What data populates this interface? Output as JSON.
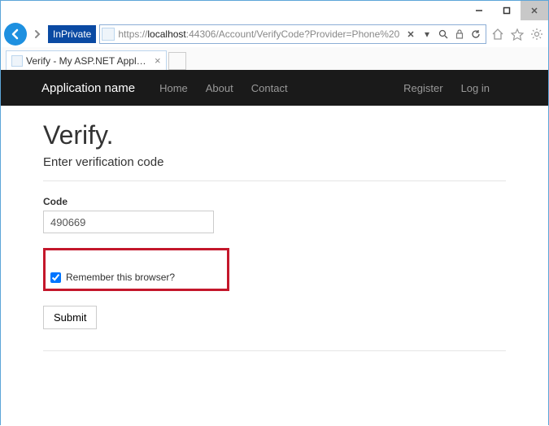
{
  "window": {
    "min": "—",
    "max": "☐",
    "close": "✕"
  },
  "browser": {
    "inprivate": "InPrivate",
    "url_prefix": "https://",
    "url_host": "localhost",
    "url_rest": ":44306/Account/VerifyCode?Provider=Phone%20",
    "tab_title": "Verify - My ASP.NET Applic..."
  },
  "nav": {
    "brand": "Application name",
    "home": "Home",
    "about": "About",
    "contact": "Contact",
    "register": "Register",
    "login": "Log in"
  },
  "page": {
    "title": "Verify.",
    "subtitle": "Enter verification code",
    "code_label": "Code",
    "code_value": "490669",
    "remember_label": "Remember this browser?",
    "remember_checked": true,
    "submit_label": "Submit"
  }
}
